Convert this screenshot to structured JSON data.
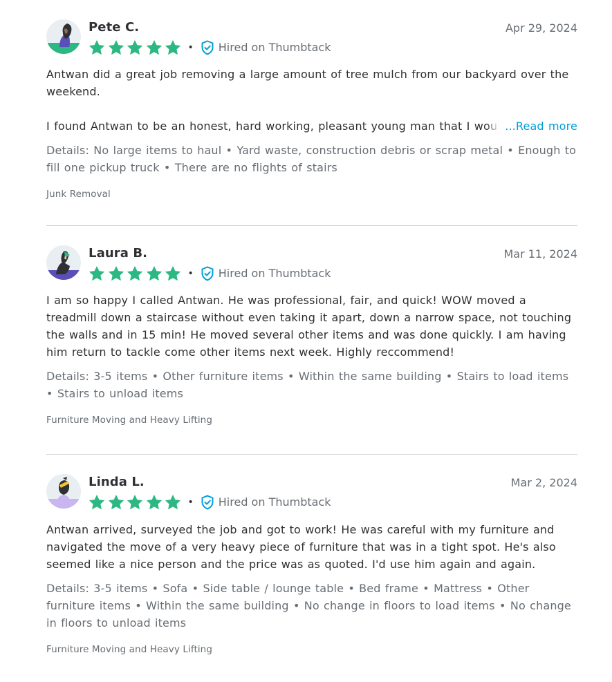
{
  "reviews": [
    {
      "name": "Pete C.",
      "date": "Apr 29, 2024",
      "rating": 5,
      "hired_label": "Hired on Thumbtack",
      "body_para1": "Antwan did a great job removing a large amount of tree mulch from our backyard over the weekend.",
      "body_para2": "I found Antwan to be an honest, hard working, pleasant young man that I would",
      "read_more": "...Read more",
      "details": "Details: No large items to haul • Yard waste, construction debris or scrap metal • Enough to fill one pickup truck • There are no flights of stairs",
      "category": "Junk Removal"
    },
    {
      "name": "Laura B.",
      "date": "Mar 11, 2024",
      "rating": 5,
      "hired_label": "Hired on Thumbtack",
      "body": "I am so happy I called Antwan. He was professional, fair, and quick! WOW moved a treadmill down a staircase without even taking it apart, down a narrow space, not touching the walls and in 15 min! He moved several other items and was done quickly. I am having him return to tackle come other items next week. Highly reccommend!",
      "details": "Details: 3-5 items • Other furniture items • Within the same building • Stairs to load items • Stairs to unload items",
      "category": "Furniture Moving and Heavy Lifting"
    },
    {
      "name": "Linda L.",
      "date": "Mar 2, 2024",
      "rating": 5,
      "hired_label": "Hired on Thumbtack",
      "body": "Antwan arrived, surveyed the job and got to work! He was careful with my furniture and navigated the move of a very heavy piece of furniture that was in a tight spot. He's also seemed like a nice person and the price was as quoted. I'd use him again and again.",
      "details": "Details: 3-5 items • Sofa • Side table / lounge table • Bed frame • Mattress • Other furniture items • Within the same building • No change in floors to load items • No change in floors to unload items",
      "category": "Furniture Moving and Heavy Lifting"
    }
  ],
  "colors": {
    "star": "#2db783",
    "link": "#009fd9",
    "verified_shield": "#009fd9",
    "text_primary": "#2f3033",
    "text_secondary": "#676d73",
    "divider": "#d3d4d5"
  },
  "icons": {
    "star": "star-icon",
    "verified": "shield-check-icon"
  }
}
